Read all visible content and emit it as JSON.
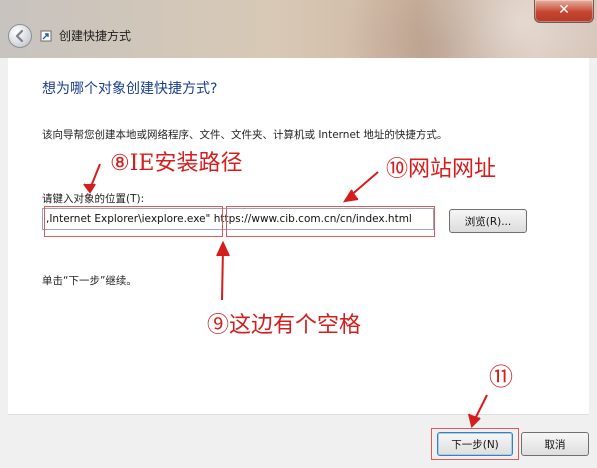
{
  "window": {
    "title": "创建快捷方式",
    "close_glyph": "✕"
  },
  "page": {
    "heading": "想为哪个对象创建快捷方式?",
    "description": "该向导帮您创建本地或网络程序、文件、文件夹、计算机或 Internet 地址的快捷方式。",
    "location_label": "请键入对象的位置(T):",
    "location_value": ",Internet Explorer\\iexplore.exe\" https://www.cib.com.cn/cn/index.html",
    "browse_label": "浏览(R)...",
    "continue_text": "单击“下一步”继续。"
  },
  "footer": {
    "next_label": "下一步(N)",
    "cancel_label": "取消"
  },
  "annotations": {
    "ie_path": "⑧IE安装路径",
    "site_url": "⑩网站网址",
    "space_note": "⑨这边有个空格",
    "next_marker": "⑪"
  },
  "icons": {
    "back": "back-arrow-icon",
    "wizard": "shortcut-wizard-icon",
    "close": "close-icon"
  },
  "colors": {
    "annotation_red": "#d61d1d",
    "heading_blue": "#1b3f8f"
  }
}
